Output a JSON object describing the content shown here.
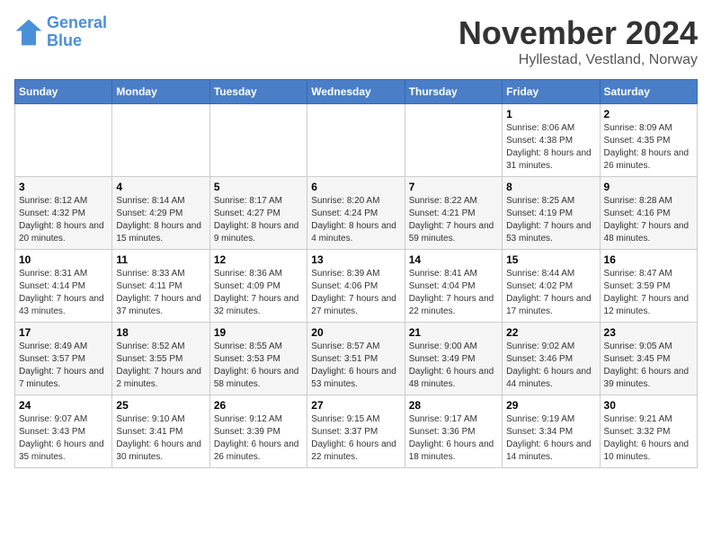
{
  "header": {
    "logo_line1": "General",
    "logo_line2": "Blue",
    "month": "November 2024",
    "location": "Hyllestad, Vestland, Norway"
  },
  "days_of_week": [
    "Sunday",
    "Monday",
    "Tuesday",
    "Wednesday",
    "Thursday",
    "Friday",
    "Saturday"
  ],
  "weeks": [
    [
      {
        "day": "",
        "info": ""
      },
      {
        "day": "",
        "info": ""
      },
      {
        "day": "",
        "info": ""
      },
      {
        "day": "",
        "info": ""
      },
      {
        "day": "",
        "info": ""
      },
      {
        "day": "1",
        "info": "Sunrise: 8:06 AM\nSunset: 4:38 PM\nDaylight: 8 hours and 31 minutes."
      },
      {
        "day": "2",
        "info": "Sunrise: 8:09 AM\nSunset: 4:35 PM\nDaylight: 8 hours and 26 minutes."
      }
    ],
    [
      {
        "day": "3",
        "info": "Sunrise: 8:12 AM\nSunset: 4:32 PM\nDaylight: 8 hours and 20 minutes."
      },
      {
        "day": "4",
        "info": "Sunrise: 8:14 AM\nSunset: 4:29 PM\nDaylight: 8 hours and 15 minutes."
      },
      {
        "day": "5",
        "info": "Sunrise: 8:17 AM\nSunset: 4:27 PM\nDaylight: 8 hours and 9 minutes."
      },
      {
        "day": "6",
        "info": "Sunrise: 8:20 AM\nSunset: 4:24 PM\nDaylight: 8 hours and 4 minutes."
      },
      {
        "day": "7",
        "info": "Sunrise: 8:22 AM\nSunset: 4:21 PM\nDaylight: 7 hours and 59 minutes."
      },
      {
        "day": "8",
        "info": "Sunrise: 8:25 AM\nSunset: 4:19 PM\nDaylight: 7 hours and 53 minutes."
      },
      {
        "day": "9",
        "info": "Sunrise: 8:28 AM\nSunset: 4:16 PM\nDaylight: 7 hours and 48 minutes."
      }
    ],
    [
      {
        "day": "10",
        "info": "Sunrise: 8:31 AM\nSunset: 4:14 PM\nDaylight: 7 hours and 43 minutes."
      },
      {
        "day": "11",
        "info": "Sunrise: 8:33 AM\nSunset: 4:11 PM\nDaylight: 7 hours and 37 minutes."
      },
      {
        "day": "12",
        "info": "Sunrise: 8:36 AM\nSunset: 4:09 PM\nDaylight: 7 hours and 32 minutes."
      },
      {
        "day": "13",
        "info": "Sunrise: 8:39 AM\nSunset: 4:06 PM\nDaylight: 7 hours and 27 minutes."
      },
      {
        "day": "14",
        "info": "Sunrise: 8:41 AM\nSunset: 4:04 PM\nDaylight: 7 hours and 22 minutes."
      },
      {
        "day": "15",
        "info": "Sunrise: 8:44 AM\nSunset: 4:02 PM\nDaylight: 7 hours and 17 minutes."
      },
      {
        "day": "16",
        "info": "Sunrise: 8:47 AM\nSunset: 3:59 PM\nDaylight: 7 hours and 12 minutes."
      }
    ],
    [
      {
        "day": "17",
        "info": "Sunrise: 8:49 AM\nSunset: 3:57 PM\nDaylight: 7 hours and 7 minutes."
      },
      {
        "day": "18",
        "info": "Sunrise: 8:52 AM\nSunset: 3:55 PM\nDaylight: 7 hours and 2 minutes."
      },
      {
        "day": "19",
        "info": "Sunrise: 8:55 AM\nSunset: 3:53 PM\nDaylight: 6 hours and 58 minutes."
      },
      {
        "day": "20",
        "info": "Sunrise: 8:57 AM\nSunset: 3:51 PM\nDaylight: 6 hours and 53 minutes."
      },
      {
        "day": "21",
        "info": "Sunrise: 9:00 AM\nSunset: 3:49 PM\nDaylight: 6 hours and 48 minutes."
      },
      {
        "day": "22",
        "info": "Sunrise: 9:02 AM\nSunset: 3:46 PM\nDaylight: 6 hours and 44 minutes."
      },
      {
        "day": "23",
        "info": "Sunrise: 9:05 AM\nSunset: 3:45 PM\nDaylight: 6 hours and 39 minutes."
      }
    ],
    [
      {
        "day": "24",
        "info": "Sunrise: 9:07 AM\nSunset: 3:43 PM\nDaylight: 6 hours and 35 minutes."
      },
      {
        "day": "25",
        "info": "Sunrise: 9:10 AM\nSunset: 3:41 PM\nDaylight: 6 hours and 30 minutes."
      },
      {
        "day": "26",
        "info": "Sunrise: 9:12 AM\nSunset: 3:39 PM\nDaylight: 6 hours and 26 minutes."
      },
      {
        "day": "27",
        "info": "Sunrise: 9:15 AM\nSunset: 3:37 PM\nDaylight: 6 hours and 22 minutes."
      },
      {
        "day": "28",
        "info": "Sunrise: 9:17 AM\nSunset: 3:36 PM\nDaylight: 6 hours and 18 minutes."
      },
      {
        "day": "29",
        "info": "Sunrise: 9:19 AM\nSunset: 3:34 PM\nDaylight: 6 hours and 14 minutes."
      },
      {
        "day": "30",
        "info": "Sunrise: 9:21 AM\nSunset: 3:32 PM\nDaylight: 6 hours and 10 minutes."
      }
    ]
  ]
}
